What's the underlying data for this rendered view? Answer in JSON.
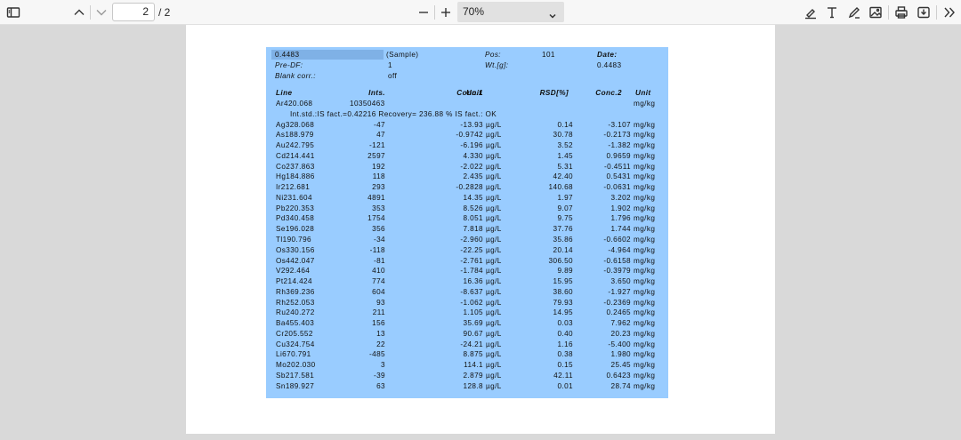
{
  "toolbar": {
    "page_current": "2",
    "page_total": "/ 2",
    "zoom": "70%"
  },
  "report": {
    "header": {
      "sample_id": "0.4483",
      "sample_type": "(Sample)",
      "pos_label": "Pos:",
      "pos_value": "101",
      "date_label": "Date:",
      "date_value": "",
      "predf_label": "Pre-DF:",
      "predf_value": "1",
      "wt_label": "Wt.[g]:",
      "wt_value": "0.4483",
      "blank_label": "Blank corr.:",
      "blank_value": "off"
    },
    "columns": {
      "line": "Line",
      "ints": "Ints.",
      "conc1": "Conc.1",
      "unit1": "Unit",
      "rsd": "RSD[%]",
      "conc2": "Conc.2",
      "unit2": "Unit"
    },
    "internal_std": {
      "name": "Ar420.068",
      "ints": "10350463",
      "unit2": "mg/kg"
    },
    "is_note": "Int.std.:IS fact.=0.42216 Recovery= 236.88 % IS fact.: OK",
    "rows": [
      {
        "line": "Ag328.068",
        "ints": "-47",
        "conc1": "-13.93",
        "unit1": "µg/L",
        "rsd": "0.14",
        "conc2": "-3.107",
        "unit2": "mg/kg"
      },
      {
        "line": "As188.979",
        "ints": "47",
        "conc1": "-0.9742",
        "unit1": "µg/L",
        "rsd": "30.78",
        "conc2": "-0.2173",
        "unit2": "mg/kg"
      },
      {
        "line": "Au242.795",
        "ints": "-121",
        "conc1": "-6.196",
        "unit1": "µg/L",
        "rsd": "3.52",
        "conc2": "-1.382",
        "unit2": "mg/kg"
      },
      {
        "line": "Cd214.441",
        "ints": "2597",
        "conc1": "4.330",
        "unit1": "µg/L",
        "rsd": "1.45",
        "conc2": "0.9659",
        "unit2": "mg/kg"
      },
      {
        "line": "Co237.863",
        "ints": "192",
        "conc1": "-2.022",
        "unit1": "µg/L",
        "rsd": "5.31",
        "conc2": "-0.4511",
        "unit2": "mg/kg"
      },
      {
        "line": "Hg184.886",
        "ints": "118",
        "conc1": "2.435",
        "unit1": "µg/L",
        "rsd": "42.40",
        "conc2": "0.5431",
        "unit2": "mg/kg"
      },
      {
        "line": "Ir212.681",
        "ints": "293",
        "conc1": "-0.2828",
        "unit1": "µg/L",
        "rsd": "140.68",
        "conc2": "-0.0631",
        "unit2": "mg/kg"
      },
      {
        "line": "Ni231.604",
        "ints": "4891",
        "conc1": "14.35",
        "unit1": "µg/L",
        "rsd": "1.97",
        "conc2": "3.202",
        "unit2": "mg/kg"
      },
      {
        "line": "Pb220.353",
        "ints": "353",
        "conc1": "8.526",
        "unit1": "µg/L",
        "rsd": "9.07",
        "conc2": "1.902",
        "unit2": "mg/kg"
      },
      {
        "line": "Pd340.458",
        "ints": "1754",
        "conc1": "8.051",
        "unit1": "µg/L",
        "rsd": "9.75",
        "conc2": "1.796",
        "unit2": "mg/kg"
      },
      {
        "line": "Se196.028",
        "ints": "356",
        "conc1": "7.818",
        "unit1": "µg/L",
        "rsd": "37.76",
        "conc2": "1.744",
        "unit2": "mg/kg"
      },
      {
        "line": "Tl190.796",
        "ints": "-34",
        "conc1": "-2.960",
        "unit1": "µg/L",
        "rsd": "35.86",
        "conc2": "-0.6602",
        "unit2": "mg/kg"
      },
      {
        "line": "Os330.156",
        "ints": "-118",
        "conc1": "-22.25",
        "unit1": "µg/L",
        "rsd": "20.14",
        "conc2": "-4.964",
        "unit2": "mg/kg"
      },
      {
        "line": "Os442.047",
        "ints": "-81",
        "conc1": "-2.761",
        "unit1": "µg/L",
        "rsd": "306.50",
        "conc2": "-0.6158",
        "unit2": "mg/kg"
      },
      {
        "line": "V292.464",
        "ints": "410",
        "conc1": "-1.784",
        "unit1": "µg/L",
        "rsd": "9.89",
        "conc2": "-0.3979",
        "unit2": "mg/kg"
      },
      {
        "line": "Pt214.424",
        "ints": "774",
        "conc1": "16.36",
        "unit1": "µg/L",
        "rsd": "15.95",
        "conc2": "3.650",
        "unit2": "mg/kg"
      },
      {
        "line": "Rh369.236",
        "ints": "604",
        "conc1": "-8.637",
        "unit1": "µg/L",
        "rsd": "38.60",
        "conc2": "-1.927",
        "unit2": "mg/kg"
      },
      {
        "line": "Rh252.053",
        "ints": "93",
        "conc1": "-1.062",
        "unit1": "µg/L",
        "rsd": "79.93",
        "conc2": "-0.2369",
        "unit2": "mg/kg"
      },
      {
        "line": "Ru240.272",
        "ints": "211",
        "conc1": "1.105",
        "unit1": "µg/L",
        "rsd": "14.95",
        "conc2": "0.2465",
        "unit2": "mg/kg"
      },
      {
        "line": "Ba455.403",
        "ints": "156",
        "conc1": "35.69",
        "unit1": "µg/L",
        "rsd": "0.03",
        "conc2": "7.962",
        "unit2": "mg/kg"
      },
      {
        "line": "Cr205.552",
        "ints": "13",
        "conc1": "90.67",
        "unit1": "µg/L",
        "rsd": "0.40",
        "conc2": "20.23",
        "unit2": "mg/kg"
      },
      {
        "line": "Cu324.754",
        "ints": "22",
        "conc1": "-24.21",
        "unit1": "µg/L",
        "rsd": "1.16",
        "conc2": "-5.400",
        "unit2": "mg/kg"
      },
      {
        "line": "Li670.791",
        "ints": "-485",
        "conc1": "8.875",
        "unit1": "µg/L",
        "rsd": "0.38",
        "conc2": "1.980",
        "unit2": "mg/kg"
      },
      {
        "line": "Mo202.030",
        "ints": "3",
        "conc1": "114.1",
        "unit1": "µg/L",
        "rsd": "0.15",
        "conc2": "25.45",
        "unit2": "mg/kg"
      },
      {
        "line": "Sb217.581",
        "ints": "-39",
        "conc1": "2.879",
        "unit1": "µg/L",
        "rsd": "42.11",
        "conc2": "0.6423",
        "unit2": "mg/kg"
      },
      {
        "line": "Sn189.927",
        "ints": "63",
        "conc1": "128.8",
        "unit1": "µg/L",
        "rsd": "0.01",
        "conc2": "28.74",
        "unit2": "mg/kg"
      }
    ]
  }
}
